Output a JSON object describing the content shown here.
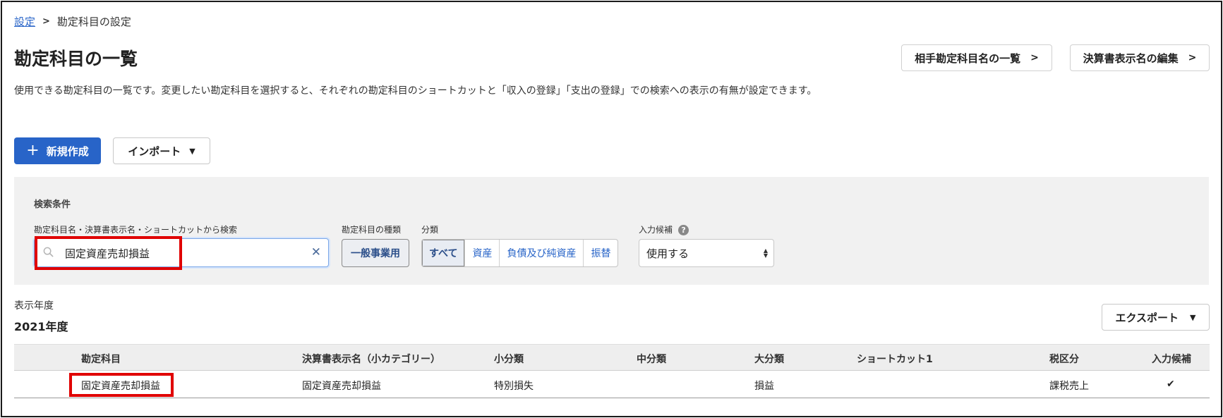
{
  "breadcrumb": {
    "parent": "設定",
    "separator": ">",
    "current": "勘定科目の設定"
  },
  "page": {
    "title": "勘定科目の一覧",
    "description": "使用できる勘定科目の一覧です。変更したい勘定科目を選択すると、それぞれの勘定科目のショートカットと「収入の登録」「支出の登録」での検索への表示の有無が設定できます。"
  },
  "header_buttons": {
    "partner_list": "相手勘定科目名の一覧",
    "report_names": "決算書表示名の編集"
  },
  "actions": {
    "new": "新規作成",
    "import": "インポート"
  },
  "filters": {
    "title": "検索条件",
    "search_label": "勘定科目名・決算書表示名・ショートカットから検索",
    "search_value": "固定資産売却損益",
    "kind_label": "勘定科目の種類",
    "kind_value": "一般事業用",
    "category_label": "分類",
    "categories": [
      "すべて",
      "資産",
      "負債及び純資産",
      "振替"
    ],
    "active_category": "すべて",
    "candidate_label": "入力候補",
    "candidate_value": "使用する"
  },
  "year": {
    "label": "表示年度",
    "value": "2021年度"
  },
  "export_label": "エクスポート",
  "table": {
    "columns": [
      "勘定科目",
      "決算書表示名（小カテゴリー）",
      "小分類",
      "中分類",
      "大分類",
      "ショートカット1",
      "税区分",
      "入力候補"
    ],
    "rows": [
      {
        "account": "固定資産売却損益",
        "report_name": "固定資産売却損益",
        "small": "特別損失",
        "middle": "",
        "large": "損益",
        "shortcut": "",
        "tax": "課税売上",
        "candidate": "✔"
      }
    ]
  },
  "colors": {
    "accent": "#2864c8",
    "highlight": "#e00000",
    "panel": "#f1f1f1"
  }
}
